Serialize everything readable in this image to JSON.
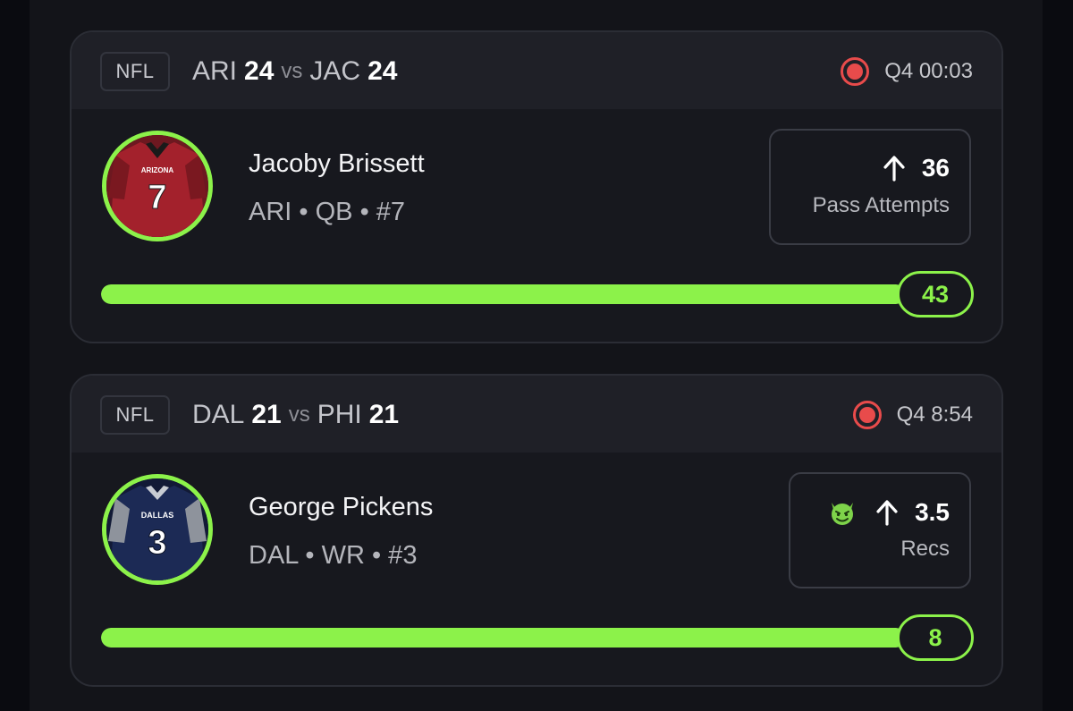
{
  "colors": {
    "accent": "#8cf24a",
    "live": "#e84b4b",
    "background": "#131419",
    "card": "#17181e",
    "card_header": "#1f2027"
  },
  "cards": [
    {
      "league": "NFL",
      "home_team": "ARI",
      "home_score": "24",
      "vs": "vs",
      "away_team": "JAC",
      "away_score": "24",
      "game_clock": "Q4 00:03",
      "live_icon": "live-record-icon",
      "player": {
        "name": "Jacoby Brissett",
        "meta": "ARI • QB • #7",
        "jersey_team_text": "ARIZONA",
        "jersey_number": "7",
        "jersey_color": "#a3212c"
      },
      "pick": {
        "direction_icon": "arrow-up-icon",
        "line": "36",
        "stat": "Pass Attempts"
      },
      "current_value": "43",
      "progress_fraction": 1.0
    },
    {
      "league": "NFL",
      "home_team": "DAL",
      "home_score": "21",
      "vs": "vs",
      "away_team": "PHI",
      "away_score": "21",
      "game_clock": "Q4 8:54",
      "live_icon": "live-record-icon",
      "player": {
        "name": "George Pickens",
        "meta": "DAL • WR • #3",
        "jersey_team_text": "DALLAS",
        "jersey_number": "3",
        "jersey_color": "#1c2a55"
      },
      "pick": {
        "badge_icon": "devil-emoji-icon",
        "direction_icon": "arrow-up-icon",
        "line": "3.5",
        "stat": "Recs"
      },
      "current_value": "8",
      "progress_fraction": 1.0
    }
  ]
}
